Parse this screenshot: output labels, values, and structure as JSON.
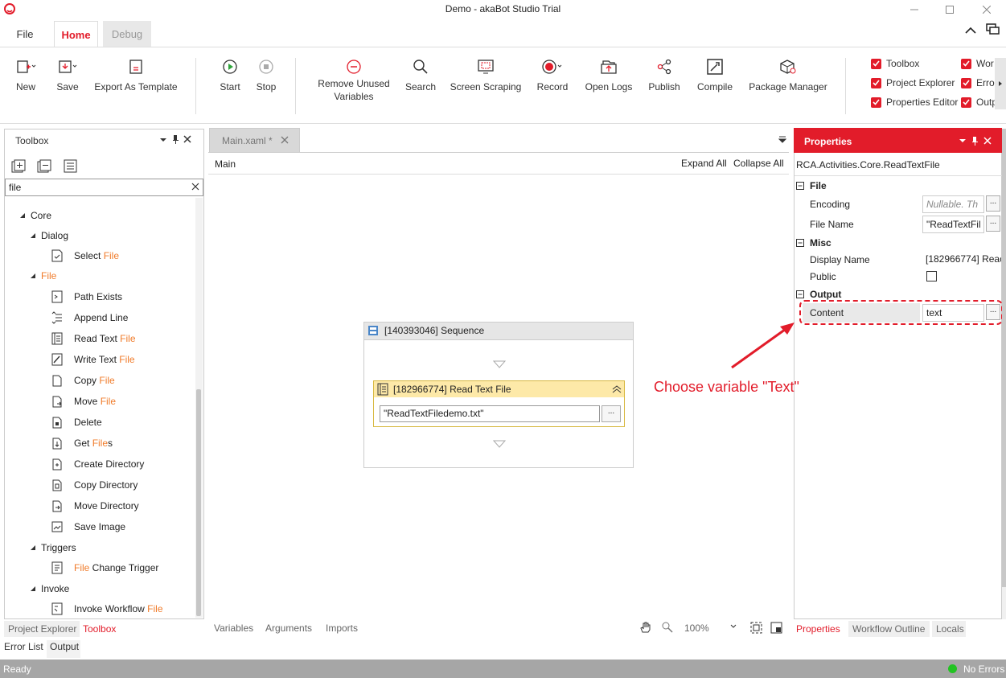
{
  "window": {
    "title": "Demo - akaBot Studio Trial"
  },
  "ribbon_tabs": [
    {
      "label": "File"
    },
    {
      "label": "Home"
    },
    {
      "label": "Debug"
    }
  ],
  "ribbon_buttons": {
    "new": "New",
    "save": "Save",
    "export_template": "Export As Template",
    "start": "Start",
    "stop": "Stop",
    "remove_unused_1": "Remove Unused",
    "remove_unused_2": "Variables",
    "search": "Search",
    "screen_scraping": "Screen Scraping",
    "record": "Record",
    "open_logs": "Open Logs",
    "publish": "Publish",
    "compile": "Compile",
    "package_manager": "Package Manager"
  },
  "panel_toggles": [
    {
      "label": "Toolbox",
      "checked": true
    },
    {
      "label": "Project Explorer",
      "checked": true
    },
    {
      "label": "Properties Editor",
      "checked": true
    },
    {
      "label": "Wor",
      "checked": true
    },
    {
      "label": "Erro",
      "checked": true
    },
    {
      "label": "Outp",
      "checked": true
    }
  ],
  "toolbox": {
    "title": "Toolbox",
    "search_value": "file",
    "categories": {
      "core": "Core",
      "dialog": "Dialog",
      "file": "File",
      "triggers": "Triggers",
      "invoke": "Invoke"
    },
    "items": [
      {
        "pre": "Select ",
        "hl": "File",
        "post": ""
      },
      {
        "pre": "Path Exists",
        "hl": "",
        "post": ""
      },
      {
        "pre": "Append Line",
        "hl": "",
        "post": ""
      },
      {
        "pre": "Read Text ",
        "hl": "File",
        "post": ""
      },
      {
        "pre": "Write Text ",
        "hl": "File",
        "post": ""
      },
      {
        "pre": "Copy ",
        "hl": "File",
        "post": ""
      },
      {
        "pre": "Move ",
        "hl": "File",
        "post": ""
      },
      {
        "pre": "Delete",
        "hl": "",
        "post": ""
      },
      {
        "pre": "Get ",
        "hl": "File",
        "post": "s"
      },
      {
        "pre": "Create Directory",
        "hl": "",
        "post": ""
      },
      {
        "pre": "Copy Directory",
        "hl": "",
        "post": ""
      },
      {
        "pre": "Move Directory",
        "hl": "",
        "post": ""
      },
      {
        "pre": "Save Image",
        "hl": "",
        "post": ""
      },
      {
        "pre": "",
        "hl": "File",
        "post": " Change Trigger"
      },
      {
        "pre": "Invoke Workflow ",
        "hl": "File",
        "post": ""
      }
    ],
    "bottom_tabs": [
      "Project Explorer",
      "Toolbox"
    ]
  },
  "bottom_left_tabs": [
    "Error List",
    "Output"
  ],
  "designer": {
    "doc_tab": "Main.xaml *",
    "breadcrumb": "Main",
    "expand_all": "Expand All",
    "collapse_all": "Collapse All",
    "sequence_title": "[140393046] Sequence",
    "activity_title": "[182966774] Read Text File",
    "activity_input": "\"ReadTextFiledemo.txt\"",
    "bottom_tabs": [
      "Variables",
      "Arguments",
      "Imports"
    ],
    "zoom": "100%"
  },
  "properties": {
    "title": "Properties",
    "type_name": "RCA.Activities.Core.ReadTextFile",
    "sections": {
      "file": "File",
      "misc": "Misc",
      "output": "Output"
    },
    "encoding_label": "Encoding",
    "encoding_placeholder": "Nullable. Th",
    "filename_label": "File Name",
    "filename_value": "\"ReadTextFil",
    "displayname_label": "Display Name",
    "displayname_value": "[182966774] Reac",
    "public_label": "Public",
    "content_label": "Content",
    "content_value": "text",
    "bottom_tabs": [
      "Properties",
      "Workflow Outline",
      "Locals"
    ]
  },
  "annotation": {
    "text": "Choose variable \"Text\""
  },
  "status": {
    "left": "Ready",
    "right": "No Errors"
  },
  "colors": {
    "accent": "#e21c2a",
    "highlight": "#f07b2a",
    "activity_header": "#fde9a8",
    "status_ok": "#22c322"
  }
}
